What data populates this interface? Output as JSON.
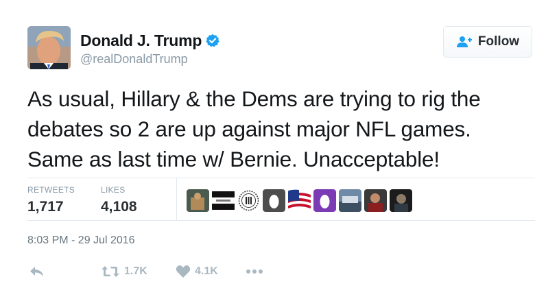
{
  "author": {
    "display_name": "Donald J. Trump",
    "handle": "@realDonaldTrump",
    "verified_icon": "verified-badge-icon",
    "verified_color": "#1da1f2"
  },
  "follow_button": {
    "label": "Follow",
    "icon": "add-user-icon",
    "icon_color": "#1da1f2"
  },
  "tweet": {
    "text_lines": [
      "As usual, Hillary & the Dems are trying to rig the",
      "debates so 2 are up against major NFL games.",
      "Same as last time w/ Bernie. Unacceptable!"
    ]
  },
  "stats": {
    "retweets_label": "RETWEETS",
    "retweets_value": "1,717",
    "likes_label": "LIKES",
    "likes_value": "4,108"
  },
  "likers": [
    {
      "icon": "liker-avatar-photo-1"
    },
    {
      "icon": "liker-avatar-black-bars"
    },
    {
      "icon": "liker-avatar-roman-numeral-three"
    },
    {
      "icon": "liker-avatar-egg-gray"
    },
    {
      "icon": "liker-avatar-us-flag"
    },
    {
      "icon": "liker-avatar-egg-purple"
    },
    {
      "icon": "liker-avatar-photo-2"
    },
    {
      "icon": "liker-avatar-photo-3"
    },
    {
      "icon": "liker-avatar-photo-4"
    }
  ],
  "timestamp": "8:03 PM - 29 Jul 2016",
  "actions": {
    "reply_icon": "reply-icon",
    "retweet_icon": "retweet-icon",
    "retweet_count": "1.7K",
    "like_icon": "heart-icon",
    "like_count": "4.1K",
    "more_icon": "more-dots-icon"
  },
  "colors": {
    "text": "#14171a",
    "secondary": "#8899a6",
    "action_gray": "#aab8c2",
    "border": "#e1e8ed",
    "accent": "#1da1f2"
  }
}
